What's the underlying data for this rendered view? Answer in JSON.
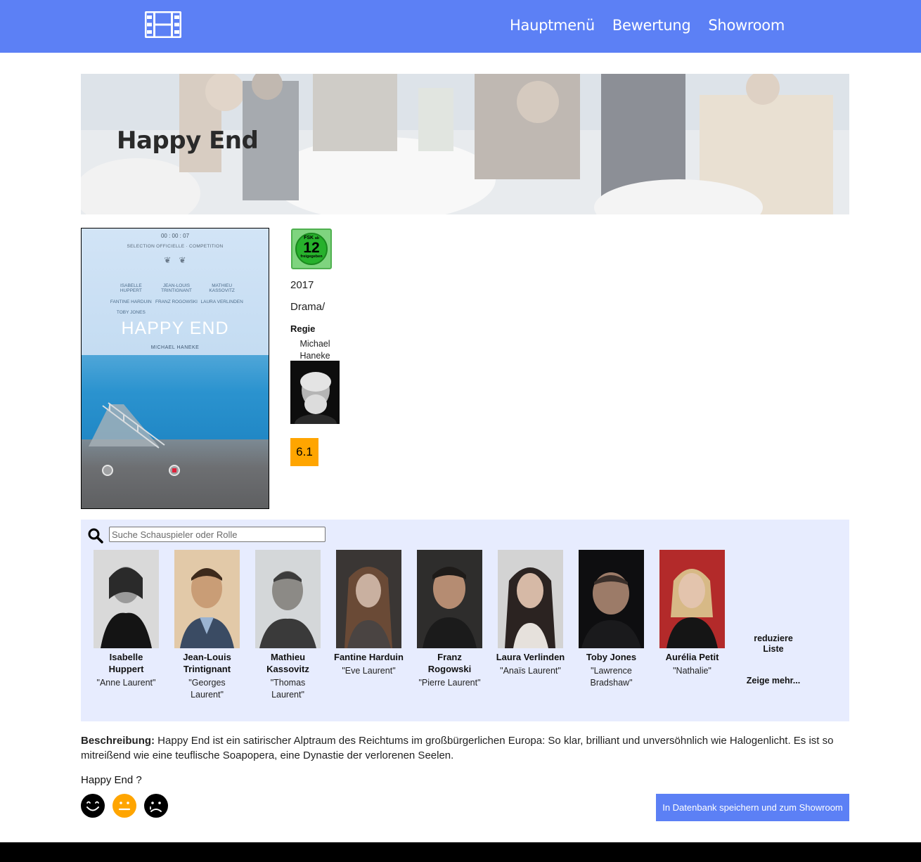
{
  "navbar": {
    "logo_icon": "film-icon",
    "links": [
      "Hauptmenü",
      "Bewertung",
      "Showroom"
    ],
    "background": "#5c80f5"
  },
  "hero": {
    "title": "Happy End"
  },
  "poster": {
    "timer": "00 : 00 : 07",
    "festival_text": "SELECTION OFFICIELLE · COMPETITION",
    "cast": [
      "ISABELLE HUPPERT",
      "JEAN-LOUIS TRINTIGNANT",
      "MATHIEU KASSOVITZ",
      "FANTINE HARDUIN",
      "FRANZ ROGOWSKI",
      "LAURA VERLINDEN",
      "TOBY JONES"
    ],
    "title": "HAPPY END",
    "director": "MICHAEL HANEKE"
  },
  "info": {
    "fsk": {
      "top": "FSK",
      "sub": "ab",
      "number": "12",
      "bottom": "freigegeben"
    },
    "year": "2017",
    "genre": "Drama/",
    "regie_label": "Regie",
    "director_name": "Michael Haneke",
    "rating": "6.1",
    "rating_color": "#ffa500"
  },
  "cast": {
    "search_placeholder": "Suche Schauspieler oder Rolle",
    "actors": [
      {
        "name": "Isabelle Huppert",
        "role": "\"Anne Laurent\""
      },
      {
        "name": "Jean-Louis Trintignant",
        "role": "\"Georges Laurent\""
      },
      {
        "name": "Mathieu Kassovitz",
        "role": "\"Thomas Laurent\""
      },
      {
        "name": "Fantine Harduin",
        "role": "\"Eve Laurent\""
      },
      {
        "name": "Franz Rogowski",
        "role": "\"Pierre Laurent\""
      },
      {
        "name": "Laura Verlinden",
        "role": "\"Anaïs Laurent\""
      },
      {
        "name": "Toby Jones",
        "role": "\"Lawrence Bradshaw\""
      },
      {
        "name": "Aurélia Petit",
        "role": "\"Nathalie\""
      }
    ],
    "reduce_label": "reduziere Liste",
    "more_label": "Zeige mehr..."
  },
  "description": {
    "label": "Beschreibung:",
    "text": " Happy End ist ein satirischer Alptraum des Reichtums im großbürgerlichen Europa: So klar, brilliant und unversöhnlich wie Halogenlicht. Es ist so mitreißend wie eine teuflische Soapopera, eine Dynastie der verlorenen Seelen."
  },
  "feedback": {
    "question": "Happy End ?",
    "smileys": [
      "smile-face-icon",
      "neutral-face-icon",
      "sad-face-icon"
    ],
    "neutral_color": "#ffa500"
  },
  "save_button": "In Datenbank speichern und zum Showroom"
}
